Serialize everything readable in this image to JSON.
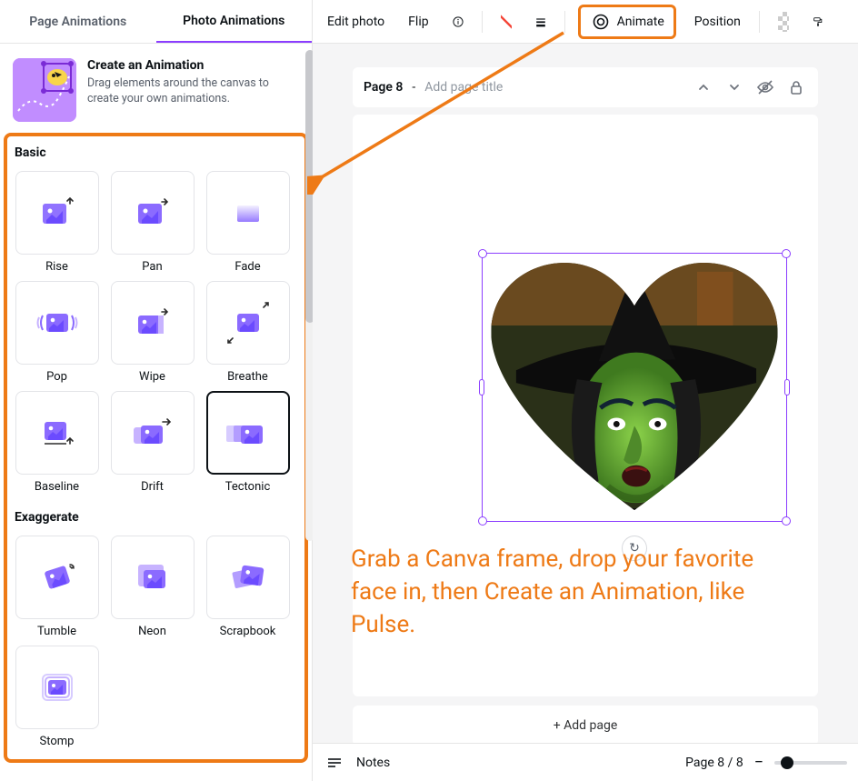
{
  "tabs": {
    "page": "Page Animations",
    "photo": "Photo Animations"
  },
  "create_animation": {
    "title": "Create an Animation",
    "desc": "Drag elements around the canvas to create your own animations."
  },
  "sections": {
    "basic": {
      "title": "Basic",
      "tiles": [
        "Rise",
        "Pan",
        "Fade",
        "Pop",
        "Wipe",
        "Breathe",
        "Baseline",
        "Drift",
        "Tectonic"
      ]
    },
    "exaggerate": {
      "title": "Exaggerate",
      "tiles": [
        "Tumble",
        "Neon",
        "Scrapbook",
        "Stomp"
      ]
    }
  },
  "toolbar": {
    "edit_photo": "Edit photo",
    "flip": "Flip",
    "animate": "Animate",
    "position": "Position"
  },
  "page_header": {
    "label": "Page 8",
    "sep": " - ",
    "placeholder": "Add page title"
  },
  "caption_text": "Grab a Canva frame, drop your favorite face in, then Create an Animation, like Pulse.",
  "add_page": "+ Add page",
  "bottom": {
    "notes": "Notes",
    "page_indicator": "Page 8 / 8"
  },
  "colors": {
    "accent": "#8b3dff",
    "annotation": "#ee7a16"
  }
}
